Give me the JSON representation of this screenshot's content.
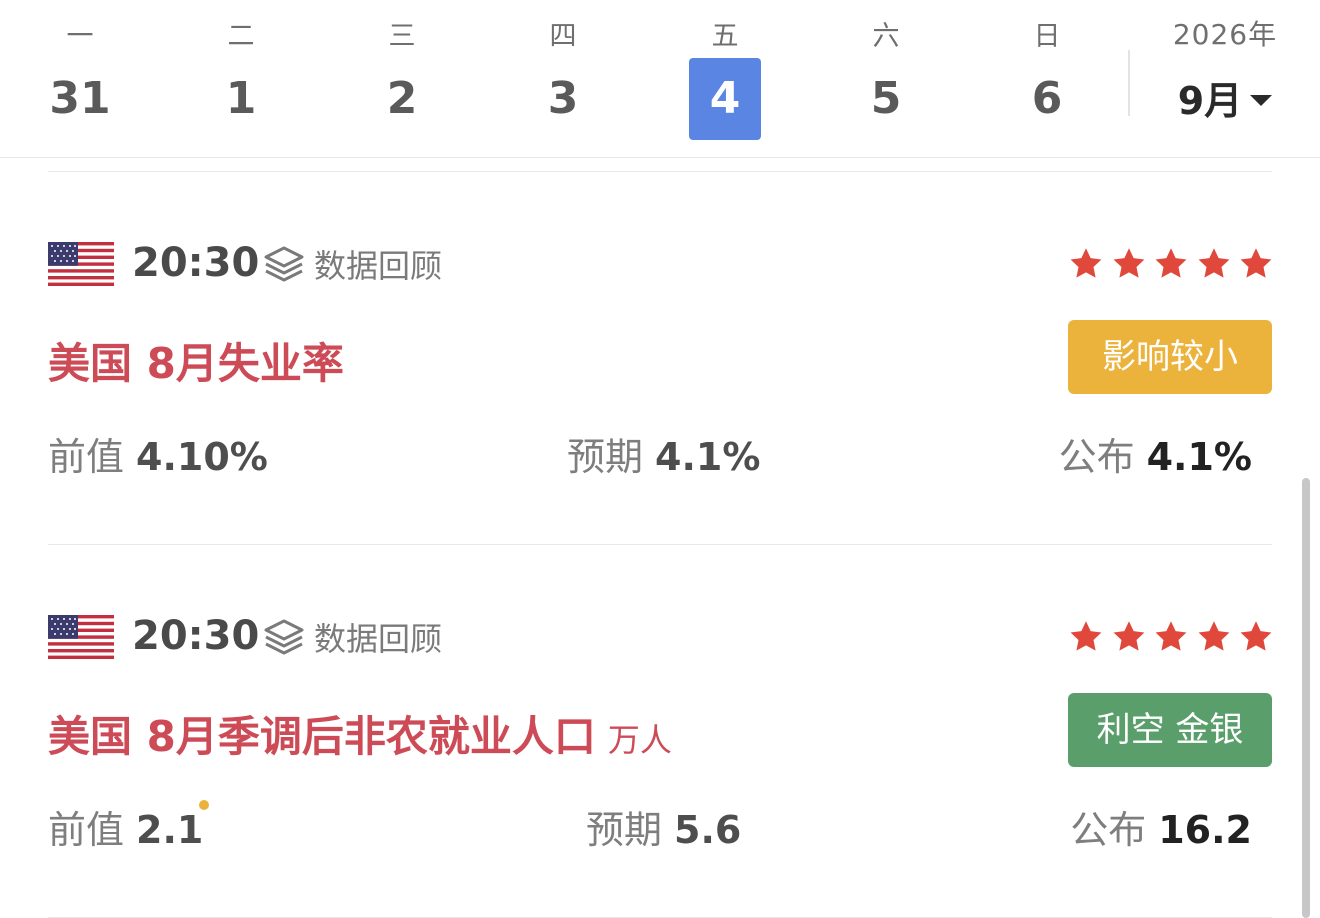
{
  "week": {
    "days": [
      {
        "weekday": "一",
        "date": "31",
        "active": false
      },
      {
        "weekday": "二",
        "date": "1",
        "active": false
      },
      {
        "weekday": "三",
        "date": "2",
        "active": false
      },
      {
        "weekday": "四",
        "date": "3",
        "active": false
      },
      {
        "weekday": "五",
        "date": "4",
        "active": true
      },
      {
        "weekday": "六",
        "date": "5",
        "active": false
      },
      {
        "weekday": "日",
        "date": "6",
        "active": false
      }
    ],
    "year": "2026年",
    "month": "9月"
  },
  "events": [
    {
      "country": "us-flag-icon",
      "time": "20:30",
      "review_label": "数据回顾",
      "importance_stars": 5,
      "title": "美国 8月失业率",
      "unit": "",
      "badge": "影响较小",
      "badge_color": "#ebb33c",
      "previous_label": "前值",
      "previous": "4.10%",
      "forecast_label": "预期",
      "forecast": "4.1%",
      "actual_label": "公布",
      "actual": "4.1%"
    },
    {
      "country": "us-flag-icon",
      "time": "20:30",
      "review_label": "数据回顾",
      "importance_stars": 5,
      "title": "美国 8月季调后非农就业人口",
      "unit": "万人",
      "badge": "利空 金银",
      "badge_color": "#5a9f6b",
      "previous_label": "前值",
      "previous": "2.1",
      "previous_revised": true,
      "forecast_label": "预期",
      "forecast": "5.6",
      "actual_label": "公布",
      "actual": "16.2"
    }
  ],
  "colors": {
    "accent_blue": "#5b85e3",
    "title_red": "#cd4b57",
    "star_red": "#e0483c",
    "badge_yellow": "#ebb33c",
    "badge_green": "#5a9f6b"
  }
}
